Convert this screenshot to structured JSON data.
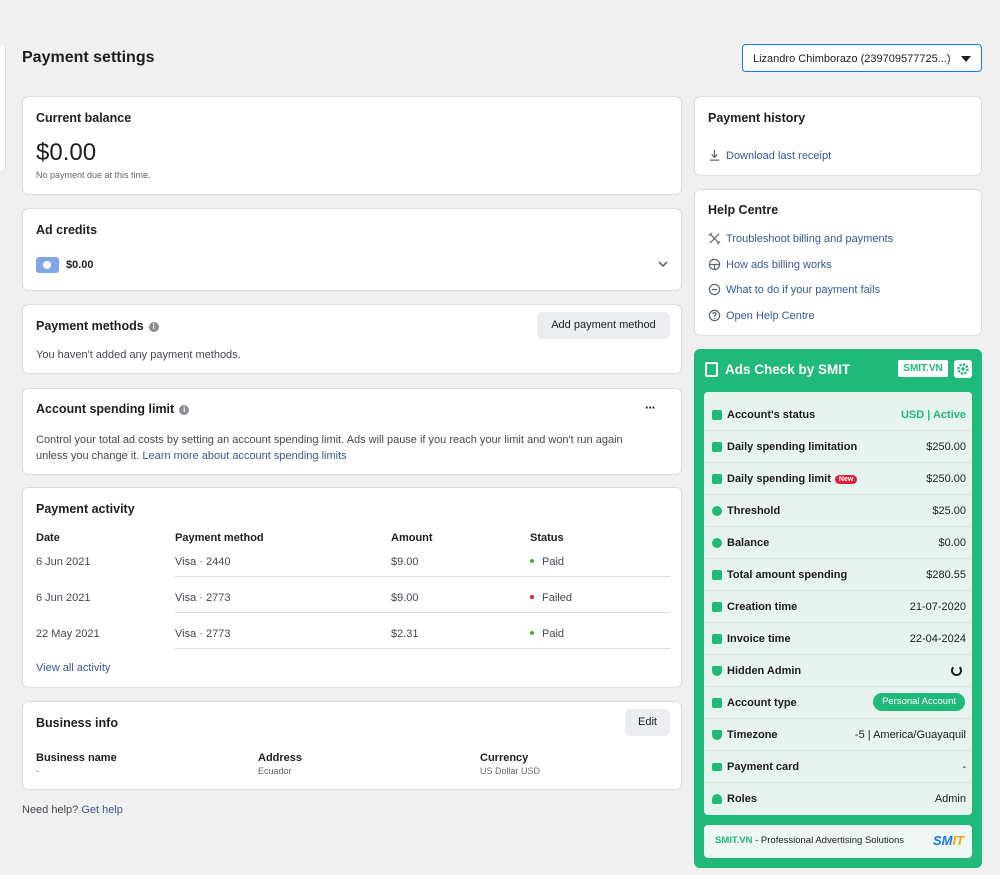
{
  "page": {
    "title": "Payment settings",
    "account_selector": "Lizandro Chimborazo (239709577725...)"
  },
  "balance": {
    "title": "Current balance",
    "amount": "$0.00",
    "note": "No payment due at this time."
  },
  "credits": {
    "title": "Ad credits",
    "amount": "$0.00"
  },
  "methods": {
    "title": "Payment methods",
    "add_button": "Add payment method",
    "empty_text": "You haven't added any payment methods."
  },
  "spending_limit": {
    "title": "Account spending limit",
    "menu": "···",
    "description": "Control your total ad costs by setting an account spending limit. Ads will pause if you reach your limit and won't run again unless you change it.",
    "link": "Learn more about account spending limits"
  },
  "activity": {
    "title": "Payment activity",
    "columns": [
      "Date",
      "Payment method",
      "Amount",
      "Status"
    ],
    "rows": [
      {
        "date": "6 Jun 2021",
        "method": "Visa · 2440",
        "amount": "$9.00",
        "status": "Paid",
        "status_color": "#42b72a"
      },
      {
        "date": "6 Jun 2021",
        "method": "Visa · 2773",
        "amount": "$9.00",
        "status": "Failed",
        "status_color": "#e41e3f"
      },
      {
        "date": "22 May 2021",
        "method": "Visa · 2773",
        "amount": "$2.31",
        "status": "Paid",
        "status_color": "#42b72a"
      }
    ],
    "view_all": "View all activity"
  },
  "business": {
    "title": "Business info",
    "edit_button": "Edit",
    "fields": [
      {
        "label": "Business name",
        "value": "-"
      },
      {
        "label": "Address",
        "value": "Ecuador"
      },
      {
        "label": "Currency",
        "value": "US Dollar USD"
      }
    ]
  },
  "footer_help": {
    "text": "Need help?",
    "link": "Get help"
  },
  "history": {
    "title": "Payment history",
    "link": "Download last receipt",
    "icon": "download-icon"
  },
  "help_centre": {
    "title": "Help Centre",
    "items": [
      {
        "label": "Troubleshoot billing and payments",
        "icon": "tools-icon"
      },
      {
        "label": "How ads billing works",
        "icon": "steering-wheel-icon"
      },
      {
        "label": "What to do if your payment fails",
        "icon": "minus-circle-icon"
      },
      {
        "label": "Open Help Centre",
        "icon": "question-circle-icon"
      }
    ]
  },
  "smit": {
    "title": "Ads Check by SMIT",
    "badge": "SMIT.VN",
    "accent": "#1fba7a",
    "rows": [
      {
        "label": "Account's status",
        "value": "USD | Active"
      },
      {
        "label": "Daily spending limitation",
        "value": "$250.00"
      },
      {
        "label": "Daily spending limit",
        "badge": "New",
        "value": "$250.00"
      },
      {
        "label": "Threshold",
        "value": "$25.00"
      },
      {
        "label": "Balance",
        "value": "$0.00"
      },
      {
        "label": "Total amount spending",
        "value": "$280.55"
      },
      {
        "label": "Creation time",
        "value": "21-07-2020"
      },
      {
        "label": "Invoice time",
        "value": "22-04-2024"
      },
      {
        "label": "Hidden Admin"
      },
      {
        "label": "Account type",
        "pill": "Personal Account"
      },
      {
        "label": "Timezone",
        "value": "-5 | America/Guayaquil"
      },
      {
        "label": "Payment card",
        "value": "-"
      },
      {
        "label": "Roles",
        "value": "Admin"
      }
    ],
    "footer_brand": "SMIT.VN",
    "footer_text": " - Professional Advertising Solutions",
    "logo_a": "SM",
    "logo_b": "IT"
  }
}
